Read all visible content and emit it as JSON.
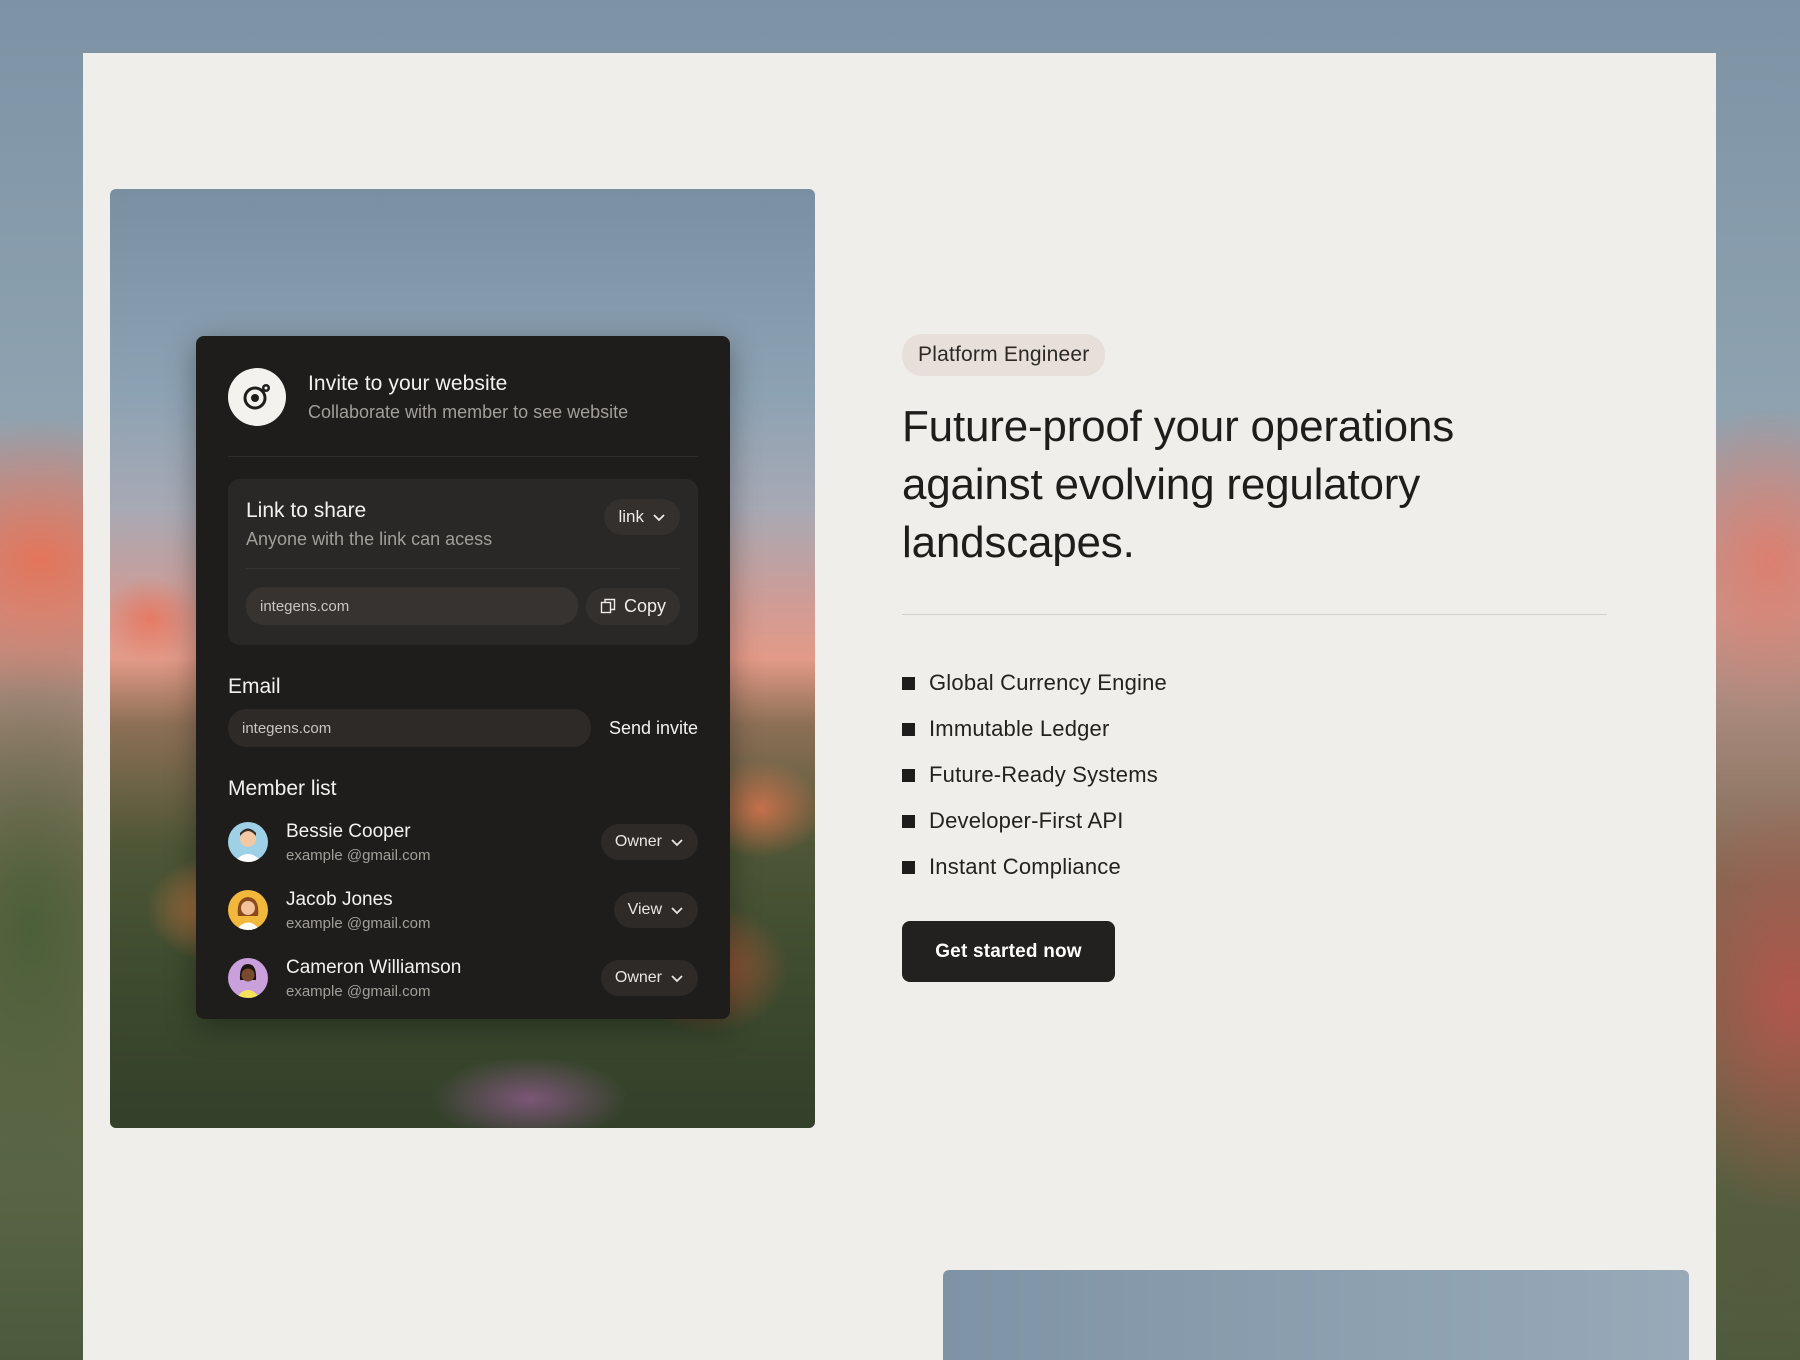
{
  "invite_card": {
    "title": "Invite to your website",
    "subtitle": "Collaborate with member to see website",
    "share": {
      "title": "Link to share",
      "subtitle": "Anyone with the link can acess",
      "mode_label": "link",
      "link_value": "integens.com",
      "copy_label": "Copy"
    },
    "email": {
      "label": "Email",
      "input_value": "integens.com",
      "send_label": "Send invite"
    },
    "members_label": "Member list",
    "members": [
      {
        "name": "Bessie Cooper",
        "email": "example @gmail.com",
        "role": "Owner",
        "avatar_color": "#9fd1e6"
      },
      {
        "name": "Jacob Jones",
        "email": "example @gmail.com",
        "role": "View",
        "avatar_color": "#f1b83c"
      },
      {
        "name": "Cameron Williamson",
        "email": "example @gmail.com",
        "role": "Owner",
        "avatar_color": "#c9a0dc"
      }
    ]
  },
  "hero": {
    "tag": "Platform Engineer",
    "headline": "Future-proof your operations against evolving regulatory landscapes.",
    "features": [
      "Global Currency Engine",
      "Immutable Ledger",
      "Future-Ready Systems",
      "Developer-First API",
      "Instant Compliance"
    ],
    "cta_label": "Get started now"
  },
  "icons": {
    "logo": "gear-person-icon",
    "dropdown": "chevron-down-icon",
    "copy": "copy-icon",
    "bullet": "square-bullet-icon"
  },
  "colors": {
    "page_bg": "#f0eeeb",
    "card_bg": "#1f1d1c",
    "cta_bg": "#23211f",
    "tag_bg": "#e7e0da"
  }
}
